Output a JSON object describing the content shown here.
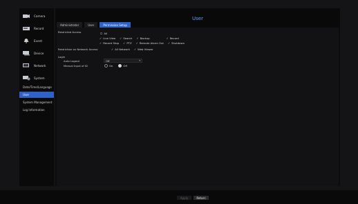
{
  "header": {
    "title": "User"
  },
  "sidebar": {
    "items": [
      {
        "label": "Camera",
        "icon": "camera-icon"
      },
      {
        "label": "Record",
        "icon": "record-icon"
      },
      {
        "label": "Event",
        "icon": "event-icon"
      },
      {
        "label": "Device",
        "icon": "device-icon"
      },
      {
        "label": "Network",
        "icon": "network-icon"
      },
      {
        "label": "System",
        "icon": "system-icon"
      }
    ],
    "sub_items": [
      {
        "label": "Date/Time/Language",
        "active": false
      },
      {
        "label": "User",
        "active": true
      },
      {
        "label": "System Management",
        "active": false
      },
      {
        "label": "Log Information",
        "active": false
      }
    ]
  },
  "tabs": [
    {
      "label": "Administrator",
      "active": false
    },
    {
      "label": "User",
      "active": false
    },
    {
      "label": "Permission Setup",
      "active": true
    }
  ],
  "restricted_access": {
    "label": "Restricted Access",
    "all_label": "All",
    "items": [
      {
        "label": "Live View",
        "mark": "✓"
      },
      {
        "label": "Search",
        "mark": "✓"
      },
      {
        "label": "Backup",
        "mark": "✓"
      },
      {
        "label": "Record",
        "mark": "✓"
      },
      {
        "label": "Record Stop",
        "mark": "✓"
      },
      {
        "label": "PTZ",
        "mark": "✓"
      },
      {
        "label": "Remote Alarm Out",
        "mark": "✓"
      },
      {
        "label": "Shutdown",
        "mark": "✓"
      }
    ]
  },
  "network_access": {
    "label": "Restriction on Network Access",
    "options": [
      {
        "label": "All Network",
        "mark": "✓"
      },
      {
        "label": "Web Viewer",
        "mark": "✓"
      }
    ]
  },
  "login": {
    "label": "Login",
    "auto_logout": {
      "label": "Auto Logout",
      "value": "Off"
    },
    "manual_input": {
      "label": "Manual Input of ID",
      "options": [
        {
          "label": "On",
          "checked": false
        },
        {
          "label": "Off",
          "checked": true
        }
      ]
    }
  },
  "footer": {
    "apply": "Apply",
    "return": "Return"
  },
  "colors": {
    "accent": "#2f62c9",
    "title": "#5fa0ff",
    "bg": "#0c0c0d"
  }
}
